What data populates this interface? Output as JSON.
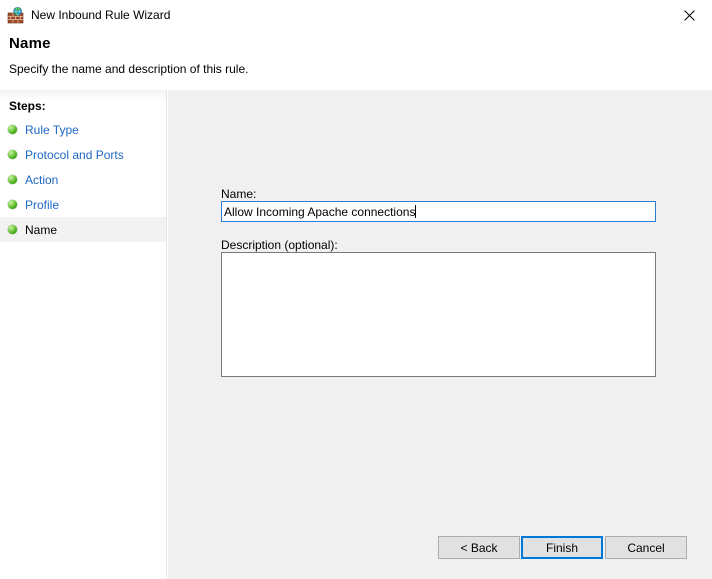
{
  "window": {
    "title": "New Inbound Rule Wizard",
    "app_icon": "firewall-brick-wall-globe-icon",
    "close_label": "✕"
  },
  "header": {
    "title": "Name",
    "subtitle": "Specify the name and description of this rule."
  },
  "sidebar": {
    "heading": "Steps:",
    "items": [
      {
        "label": "Rule Type",
        "state": "completed"
      },
      {
        "label": "Protocol and Ports",
        "state": "completed"
      },
      {
        "label": "Action",
        "state": "completed"
      },
      {
        "label": "Profile",
        "state": "completed"
      },
      {
        "label": "Name",
        "state": "current"
      }
    ]
  },
  "main": {
    "name_label": "Name:",
    "name_value": "Allow Incoming Apache connections",
    "description_label": "Description (optional):",
    "description_value": "",
    "description_placeholder": ""
  },
  "footer": {
    "back_label": "< Back",
    "finish_label": "Finish",
    "cancel_label": "Cancel"
  },
  "colors": {
    "accent_blue": "#0078d7",
    "link_blue": "#1f68c4",
    "panel_gray": "#f0f0f0",
    "button_face": "#e1e1e1",
    "bullet_green": "#3ba312"
  }
}
